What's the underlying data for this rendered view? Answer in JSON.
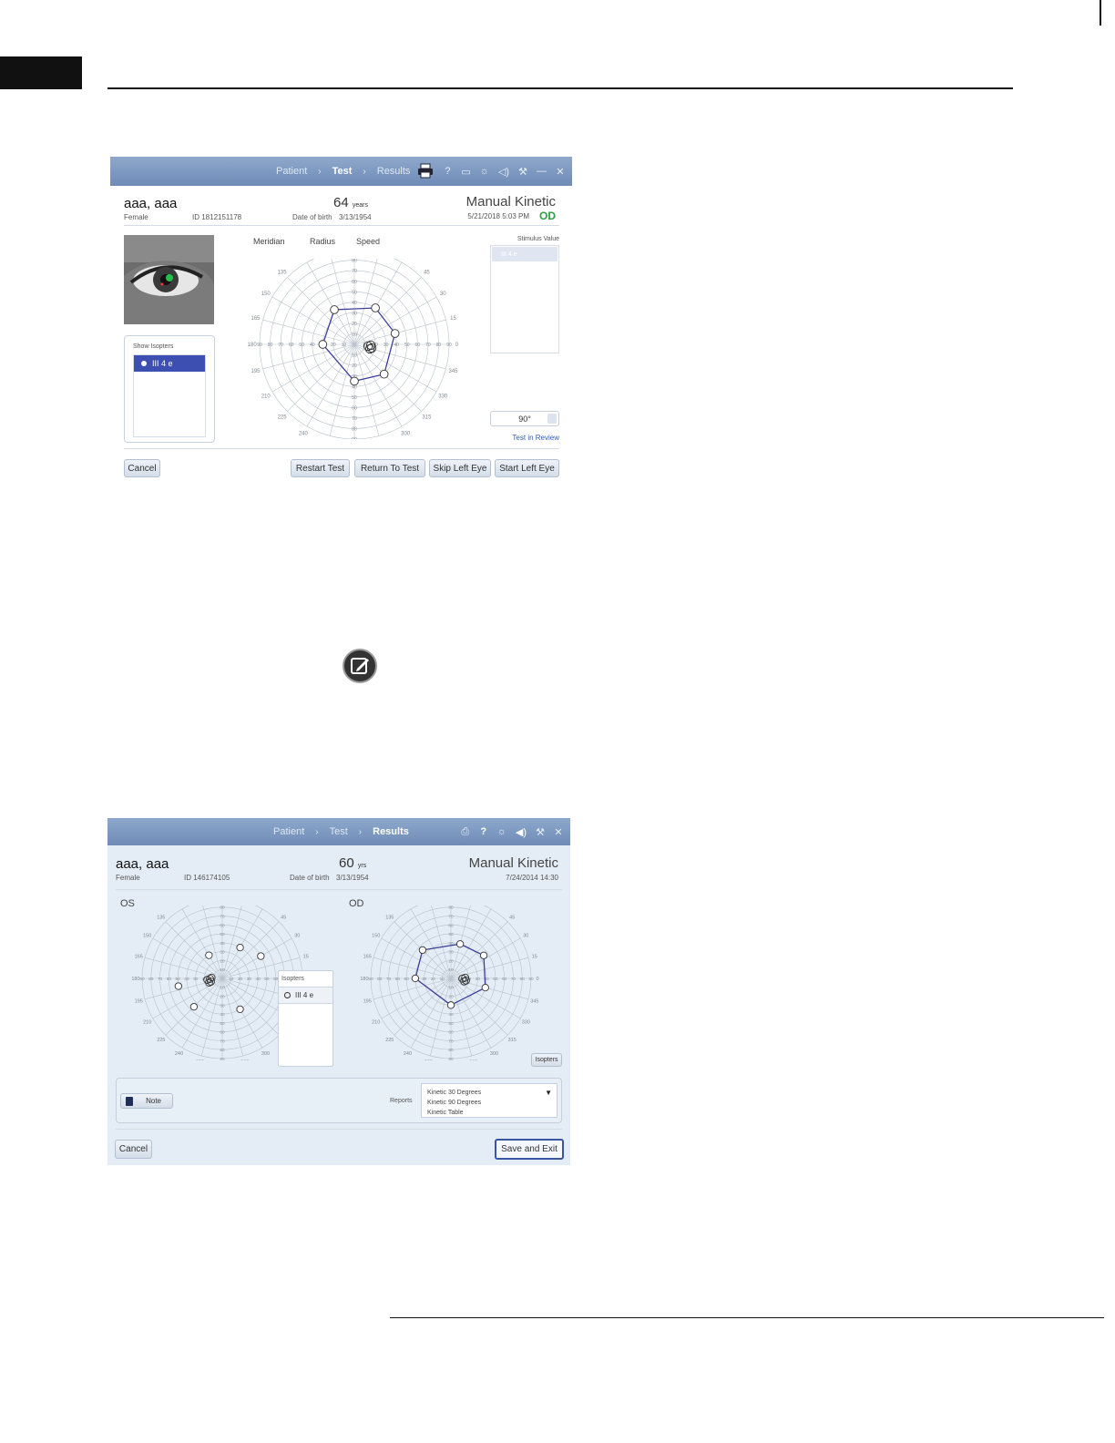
{
  "screen1": {
    "nav": {
      "patient": "Patient",
      "sep": "›",
      "test": "Test",
      "results": "Results"
    },
    "toolbar_icons": [
      "print-icon",
      "help-icon",
      "display-icon",
      "light-icon",
      "sound-icon",
      "wrench-icon",
      "minimize-icon",
      "close-icon"
    ],
    "patient": {
      "name": "aaa, aaa",
      "gender": "Female",
      "id": "ID 1812151178",
      "age": "64",
      "age_unit": "years",
      "dob_label": "Date of birth",
      "dob": "3/13/1954"
    },
    "test_type": "Manual Kinetic",
    "datetime": "5/21/2018 5:03 PM",
    "eye": "OD",
    "columns": {
      "meridian": "Meridian",
      "radius": "Radius",
      "speed": "Speed"
    },
    "show_isopters_title": "Show Isopters",
    "isopter": "III 4 e",
    "stimulus_value_title": "Stimulus Value",
    "stimulus_selected": "III 4 e",
    "degree": "90°",
    "test_in_review": "Test in Review",
    "buttons": {
      "cancel": "Cancel",
      "restart": "Restart Test",
      "return": "Return To Test",
      "skip": "Skip Left Eye",
      "start": "Start Left Eye"
    },
    "colors": {
      "isopter_line": "#3d3f9a",
      "accent": "#3d4fb0",
      "od_green": "#2ea043"
    }
  },
  "screen2": {
    "nav": {
      "patient": "Patient",
      "sep": "›",
      "test": "Test",
      "results": "Results"
    },
    "toolbar_icons": [
      "print-icon",
      "help-icon",
      "light-icon",
      "sound-icon",
      "wrench-icon",
      "close-icon"
    ],
    "patient": {
      "name": "aaa, aaa",
      "gender": "Female",
      "id": "ID 146174105",
      "age": "60",
      "age_unit": "yrs",
      "dob_label": "Date of birth",
      "dob": "3/13/1954"
    },
    "test_type": "Manual Kinetic",
    "datetime": "7/24/2014 14:30",
    "os_label": "OS",
    "od_label": "OD",
    "isopters_popup_title": "Isopters",
    "isopter": "III 4 e",
    "isopters_button": "Isopters",
    "note_button": "Note",
    "reports_label": "Reports",
    "reports": [
      "Kinetic 30 Degrees",
      "Kinetic 90 Degrees",
      "Kinetic Table"
    ],
    "buttons": {
      "cancel": "Cancel",
      "save": "Save and Exit"
    }
  },
  "chart_data": [
    {
      "type": "scatter",
      "name_ref": "screen1 OD polar plot",
      "meridian_labels": [
        "0",
        "15",
        "30",
        "45",
        "60",
        "75",
        "90",
        "105",
        "120",
        "135",
        "150",
        "165",
        "180",
        "195",
        "210",
        "225",
        "240",
        "255",
        "270",
        "285",
        "300",
        "315",
        "330",
        "345"
      ],
      "radius_labels": [
        "10",
        "20",
        "30",
        "40",
        "50",
        "60",
        "70",
        "80",
        "90"
      ],
      "rlim": [
        0,
        90
      ],
      "isopter": "III 4 e",
      "points": [
        {
          "meridian": 60,
          "radius": 40
        },
        {
          "meridian": 15,
          "radius": 40
        },
        {
          "meridian": 315,
          "radius": 40
        },
        {
          "meridian": 270,
          "radius": 35
        },
        {
          "meridian": 180,
          "radius": 30
        },
        {
          "meridian": 120,
          "radius": 38
        }
      ],
      "closed": true,
      "blind_spot": {
        "meridian": 350,
        "radius": 15
      }
    },
    {
      "type": "scatter",
      "name_ref": "screen2 OS polar plot",
      "meridian_labels": [
        "0",
        "15",
        "30",
        "45",
        "60",
        "75",
        "90",
        "105",
        "120",
        "135",
        "150",
        "165",
        "180",
        "195",
        "210",
        "225",
        "240",
        "255",
        "270",
        "285",
        "300",
        "315",
        "330",
        "345"
      ],
      "radius_labels": [
        "10",
        "20",
        "30",
        "40",
        "50",
        "60",
        "70",
        "80",
        "90"
      ],
      "rlim": [
        0,
        90
      ],
      "points": [
        {
          "meridian": 60,
          "radius": 40
        },
        {
          "meridian": 30,
          "radius": 50
        },
        {
          "meridian": 120,
          "radius": 30
        },
        {
          "meridian": 190,
          "radius": 50
        },
        {
          "meridian": 225,
          "radius": 45
        },
        {
          "meridian": 300,
          "radius": 40
        },
        {
          "meridian": 175,
          "radius": 12
        }
      ],
      "closed": false,
      "blind_spot": {
        "meridian": 190,
        "radius": 15
      }
    },
    {
      "type": "scatter",
      "name_ref": "screen2 OD polar plot",
      "meridian_labels": [
        "0",
        "15",
        "30",
        "45",
        "60",
        "75",
        "90",
        "105",
        "120",
        "135",
        "150",
        "165",
        "180",
        "195",
        "210",
        "225",
        "240",
        "255",
        "270",
        "285",
        "300",
        "315",
        "330",
        "345"
      ],
      "radius_labels": [
        "10",
        "20",
        "30",
        "40",
        "50",
        "60",
        "70",
        "80",
        "90"
      ],
      "rlim": [
        0,
        90
      ],
      "points": [
        {
          "meridian": 75,
          "radius": 40
        },
        {
          "meridian": 35,
          "radius": 45
        },
        {
          "meridian": 345,
          "radius": 40
        },
        {
          "meridian": 270,
          "radius": 30
        },
        {
          "meridian": 180,
          "radius": 40
        },
        {
          "meridian": 135,
          "radius": 45
        }
      ],
      "closed": true,
      "blind_spot": {
        "meridian": 355,
        "radius": 15
      }
    }
  ]
}
